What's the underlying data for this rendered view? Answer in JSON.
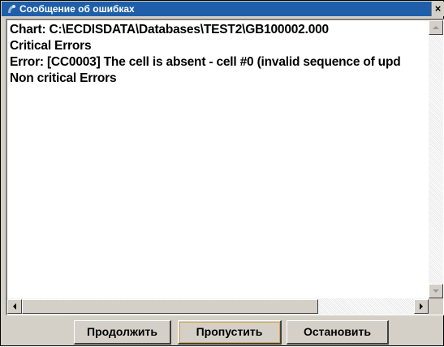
{
  "window": {
    "title": "Сообщение об ошибках",
    "close_glyph": "×"
  },
  "log": {
    "lines": [
      "Chart: C:\\ECDISDATA\\Databases\\TEST2\\GB100002.000",
      "Critical Errors",
      "Error: [CC0003] The cell is absent - cell #0 (invalid sequence of upd",
      "Non critical Errors"
    ]
  },
  "buttons": {
    "continue_label": "Продолжить",
    "skip_label": "Пропустить",
    "stop_label": "Остановить"
  },
  "colors": {
    "titlebar": "#1f5faa",
    "dialog_bg": "#d4d0c8",
    "focus_outline": "#d9a74a"
  },
  "icons": {
    "title": "app-icon",
    "close": "close-icon",
    "scroll_up": "arrow-up-icon",
    "scroll_down": "arrow-down-icon",
    "scroll_left": "arrow-left-icon",
    "scroll_right": "arrow-right-icon"
  }
}
